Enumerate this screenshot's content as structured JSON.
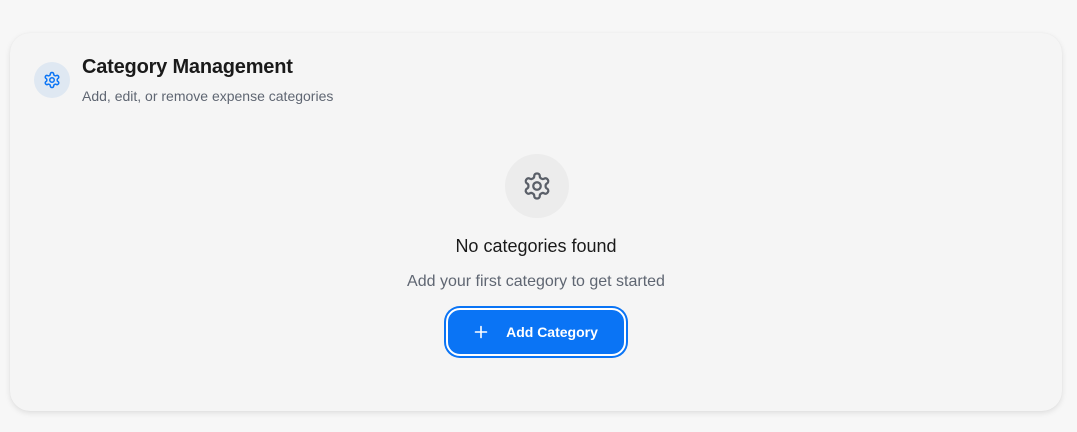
{
  "header": {
    "title": "Category Management",
    "subtitle": "Add, edit, or remove expense categories",
    "icon": "gear-icon"
  },
  "empty_state": {
    "icon": "gear-icon",
    "title": "No categories found",
    "description": "Add your first category to get started"
  },
  "actions": {
    "add_category_label": "Add Category",
    "add_icon": "plus-icon"
  },
  "colors": {
    "accent": "#0a74f5",
    "header_icon_bg": "#dfe8f2",
    "empty_icon_bg": "#ececec",
    "muted_text": "#5f6672"
  }
}
